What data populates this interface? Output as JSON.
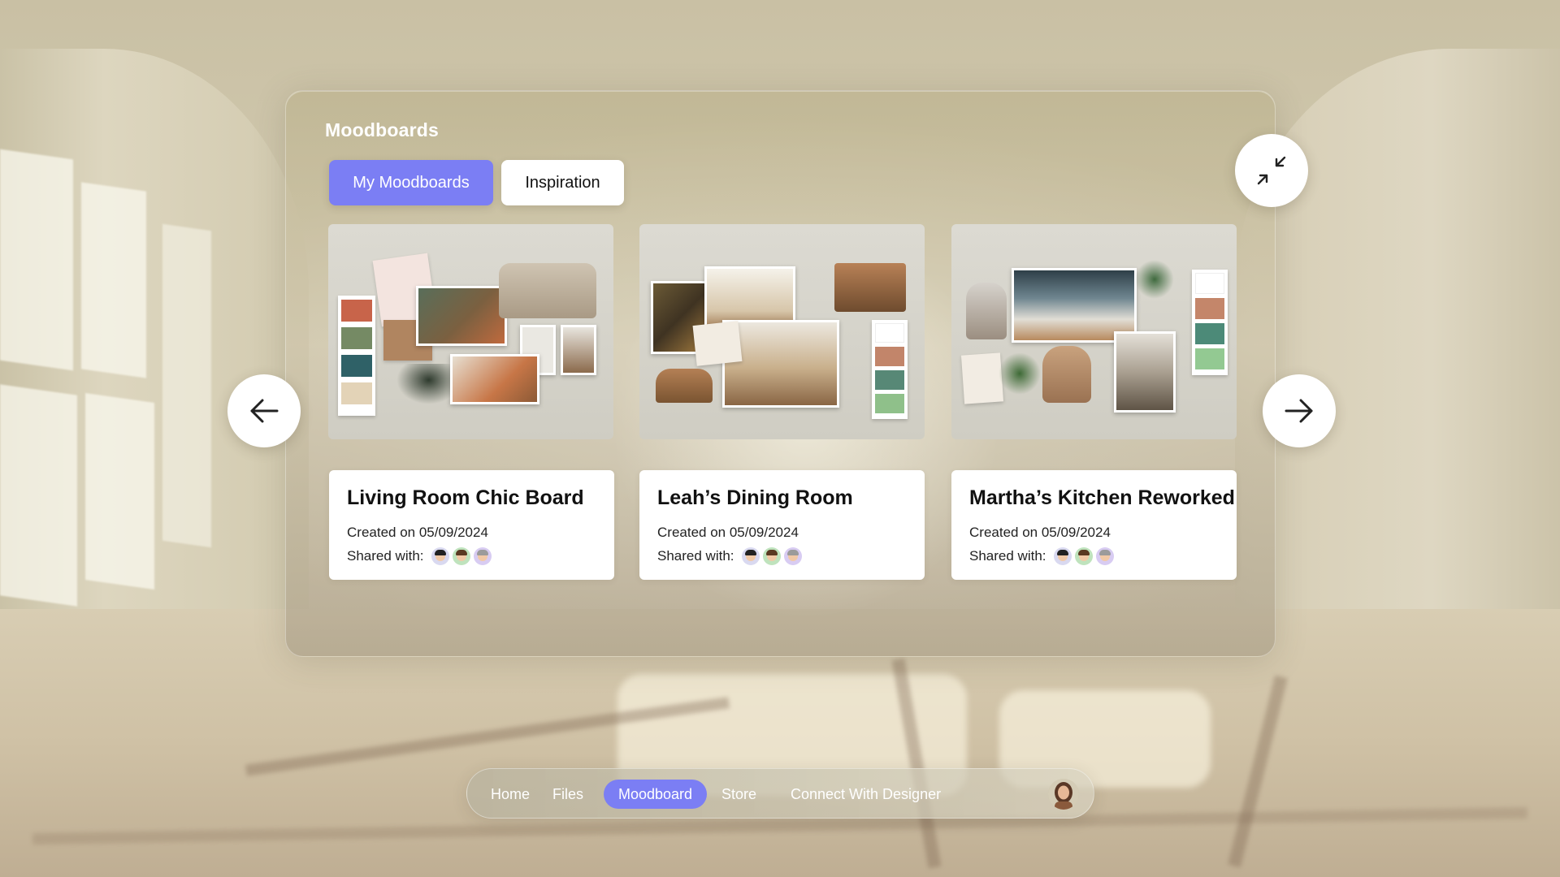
{
  "panel": {
    "title": "Moodboards",
    "tabs": [
      {
        "label": "My Moodboards",
        "active": true
      },
      {
        "label": "Inspiration",
        "active": false
      }
    ]
  },
  "cards": [
    {
      "title": "Living Room Chic Board",
      "created": "Created on 05/09/2024",
      "shared_label": "Shared with:",
      "swatches": [
        "#c8644a",
        "#758a64",
        "#2f6167",
        "#e3d3b7"
      ]
    },
    {
      "title": "Leah’s Dining Room",
      "created": "Created on 05/09/2024",
      "shared_label": "Shared with:",
      "swatches": [
        "#ffffff",
        "#c2856a",
        "#578876",
        "#8fc08a"
      ]
    },
    {
      "title": "Martha’s Kitchen Reworked",
      "created": "Created on 05/09/2024",
      "shared_label": "Shared with:",
      "swatches": [
        "#ffffff",
        "#c4866a",
        "#4c8a78",
        "#93c992"
      ]
    }
  ],
  "nav": {
    "items": [
      {
        "label": "Home",
        "active": false
      },
      {
        "label": "Files",
        "active": false
      },
      {
        "label": "Moodboard",
        "active": true
      },
      {
        "label": "Store",
        "active": false
      },
      {
        "label": "Connect With Designer",
        "active": false
      }
    ]
  },
  "icons": {
    "collapse": "collapse-arrows-icon",
    "prev": "arrow-left-icon",
    "next": "arrow-right-icon"
  },
  "colors": {
    "accent": "#7b7ef4",
    "card_bg": "#ffffff"
  }
}
